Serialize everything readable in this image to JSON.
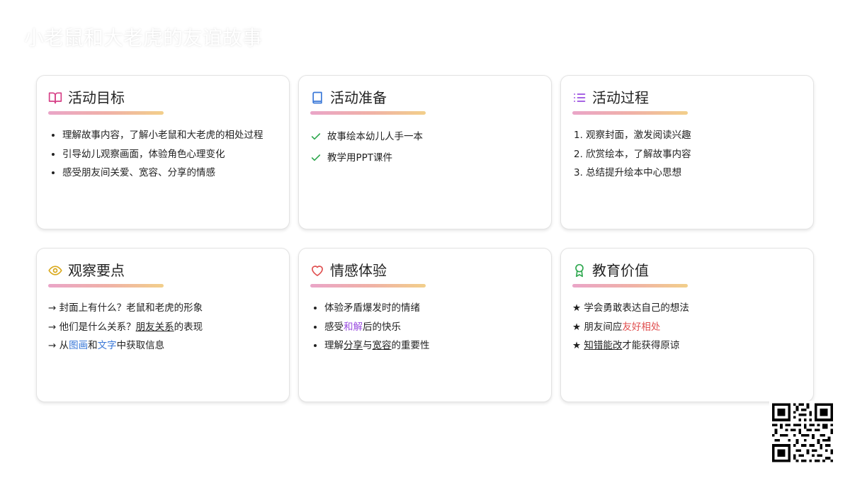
{
  "page": {
    "title": "小老鼠和大老虎的友谊故事"
  },
  "colors": {
    "underline_gradient": [
      "#eaa5c8",
      "#f0b0a8",
      "#f2cf8a"
    ],
    "icon_pink": "#d63f86",
    "icon_blue": "#3a78d8",
    "icon_purple": "#9b4fe0",
    "icon_yellow": "#d9a81a",
    "icon_red": "#e05050",
    "icon_green": "#2fa84f",
    "check_green": "#2fa84f"
  },
  "cards": {
    "goals": {
      "title": "活动目标",
      "icon": "book-open-icon",
      "items": [
        "理解故事内容，了解小老鼠和大老虎的相处过程",
        "引导幼儿观察画面，体验角色心理变化",
        "感受朋友间关爱、宽容、分享的情感"
      ]
    },
    "prep": {
      "title": "活动准备",
      "icon": "book-icon",
      "items": [
        "故事绘本幼儿人手一本",
        "教学用PPT课件"
      ]
    },
    "process": {
      "title": "活动过程",
      "icon": "list-icon",
      "items": [
        "1. 观察封面，激发阅读兴趣",
        "2. 欣赏绘本，了解故事内容",
        "3. 总结提升绘本中心思想"
      ]
    },
    "observe": {
      "title": "观察要点",
      "icon": "eye-icon",
      "item1": "→ 封面上有什么？老鼠和老虎的形象",
      "item2_prefix": "→ 他们是什么关系？",
      "item2_link": "朋友关系",
      "item2_suffix": "的表现",
      "item3_prefix": "→ 从",
      "item3_a": "图画",
      "item3_mid": "和",
      "item3_b": "文字",
      "item3_suffix": "中获取信息"
    },
    "emotion": {
      "title": "情感体验",
      "icon": "heart-icon",
      "item1": "体验矛盾爆发时的情绪",
      "item2_prefix": "感受",
      "item2_hl": "和解",
      "item2_suffix": "后的快乐",
      "item3_prefix": "理解",
      "item3_a": "分享",
      "item3_mid": "与",
      "item3_b": "宽容",
      "item3_suffix": "的重要性"
    },
    "value": {
      "title": "教育价值",
      "icon": "award-icon",
      "item1": "★ 学会勇敢表达自己的想法",
      "item2_prefix": "★ 朋友间应",
      "item2_hl": "友好相处",
      "item3_prefix": "★ ",
      "item3_ul": "知错能改",
      "item3_suffix": "才能获得原谅"
    }
  },
  "qr": {
    "icon": "qr-code-icon"
  }
}
